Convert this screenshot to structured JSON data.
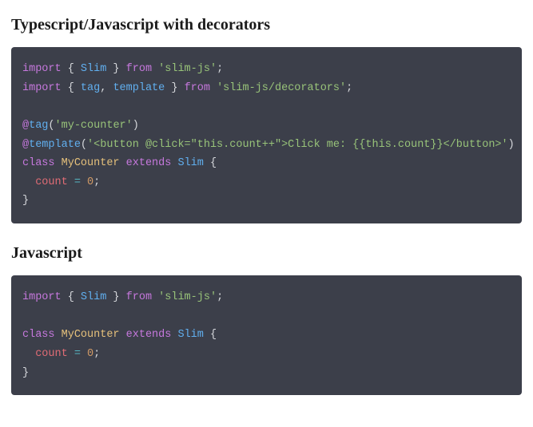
{
  "sections": [
    {
      "heading": "Typescript/Javascript with decorators",
      "code": {
        "line1": {
          "kw1": "import",
          "b1": "{ ",
          "id1": "Slim",
          "b2": " }",
          "kw2": "from",
          "str": "'slim-js'",
          "end": ";"
        },
        "line2": {
          "kw1": "import",
          "b1": "{ ",
          "id1": "tag",
          "c": ", ",
          "id2": "template",
          "b2": " }",
          "kw2": "from",
          "str": "'slim-js/decorators'",
          "end": ";"
        },
        "line3": {
          "at": "@",
          "dec": "tag",
          "p1": "(",
          "str": "'my-counter'",
          "p2": ")"
        },
        "line4": {
          "at": "@",
          "dec": "template",
          "p1": "(",
          "str": "'<button @click=\"this.count++\">Click me: {{this.count}}</button>'",
          "p2": ")"
        },
        "line5": {
          "kw1": "class",
          "cls": "MyCounter",
          "kw2": "extends",
          "sup": "Slim",
          "b": "{"
        },
        "line6": {
          "prop": "count",
          "op": "=",
          "num": "0",
          "end": ";"
        },
        "line7": {
          "b": "}"
        }
      }
    },
    {
      "heading": "Javascript",
      "code": {
        "line1": {
          "kw1": "import",
          "b1": "{ ",
          "id1": "Slim",
          "b2": " }",
          "kw2": "from",
          "str": "'slim-js'",
          "end": ";"
        },
        "line2": {
          "kw1": "class",
          "cls": "MyCounter",
          "kw2": "extends",
          "sup": "Slim",
          "b": "{"
        },
        "line3": {
          "prop": "count",
          "op": "=",
          "num": "0",
          "end": ";"
        },
        "line4": {
          "b": "}"
        }
      }
    }
  ]
}
